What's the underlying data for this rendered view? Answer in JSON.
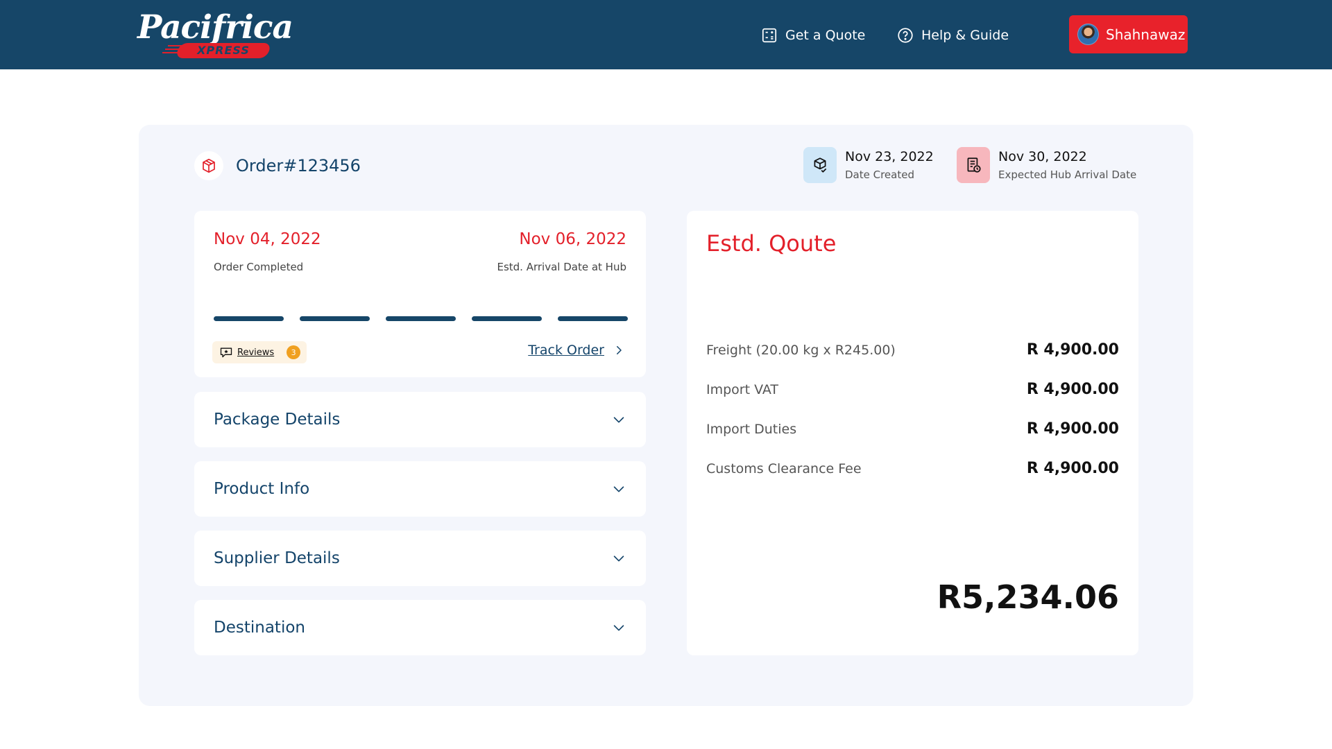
{
  "header": {
    "logo_main": "Pacifrica",
    "logo_sub": "XPRESS",
    "nav": [
      {
        "label": "Get a Quote",
        "icon": "calculator-icon"
      },
      {
        "label": "Help & Guide",
        "icon": "help-circle-icon"
      }
    ],
    "user": {
      "name": "Shahnawaz",
      "icon": "avatar"
    }
  },
  "order": {
    "title": "Order#123456",
    "date_created": "Nov 23, 2022",
    "date_created_label": "Date Created",
    "hub_arrival": "Nov 30, 2022",
    "hub_arrival_label": "Expected Hub Arrival Date"
  },
  "progress": {
    "start_date": "Nov 04, 2022",
    "start_label": "Order Completed",
    "end_date": "Nov 06, 2022",
    "end_label": "Estd. Arrival Date at Hub",
    "steps_total": 5,
    "steps_completed": 5,
    "reviews_label": "Reviews",
    "reviews_count": "3",
    "track_label": "Track Order"
  },
  "sections": [
    {
      "label": "Package Details"
    },
    {
      "label": "Product Info"
    },
    {
      "label": "Supplier Details"
    },
    {
      "label": "Destination"
    }
  ],
  "quote": {
    "title": "Estd. Qoute",
    "rows": [
      {
        "label": "Freight (20.00 kg x R245.00)",
        "value": "R 4,900.00"
      },
      {
        "label": "Import VAT",
        "value": "R 4,900.00"
      },
      {
        "label": "Import Duties",
        "value": "R 4,900.00"
      },
      {
        "label": "Customs Clearance Fee",
        "value": "R 4,900.00"
      }
    ],
    "total": "R5,234.06"
  },
  "colors": {
    "navy": "#164668",
    "accent_red": "#e3202a",
    "panel_bg": "#f4f6fc",
    "badge_orange": "#f0a020"
  }
}
